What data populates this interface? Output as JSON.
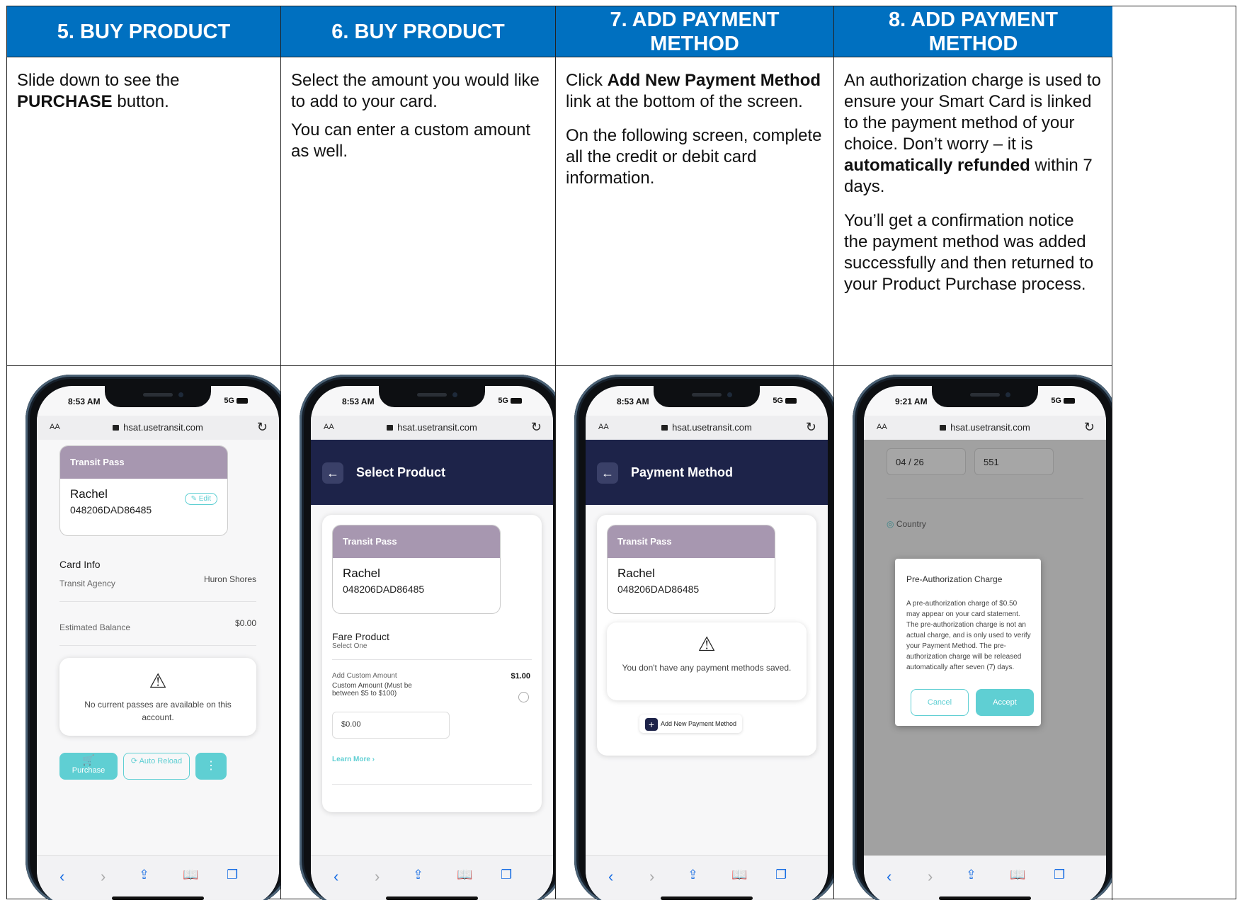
{
  "columns": [
    {
      "header": "5.  BUY PRODUCT",
      "desc": [
        "Slide down to see the",
        "PURCHASE",
        " button."
      ]
    },
    {
      "header": "6.  BUY PRODUCT",
      "desc1": "Select the amount you would like to add to your card.",
      "desc2": "You can enter a custom amount as well."
    },
    {
      "header": "7.  ADD PAYMENT METHOD",
      "desc1a": "Click ",
      "desc1b": "Add New Payment Method",
      "desc1c": " link at the bottom of the screen.",
      "desc2": "On the following screen, complete all the credit or debit card information."
    },
    {
      "header": "8.  ADD PAYMENT METHOD",
      "desc1a": "An authorization charge is used to ensure your Smart Card is linked to the payment method of your choice. Don’t worry – it is ",
      "desc1b": "automatically refunded",
      "desc1c": " within 7 days.",
      "desc2": "You’ll get a confirmation notice the payment method was added successfully and then returned to your Product Purchase process."
    }
  ],
  "phone": {
    "url": "hsat.usetransit.com",
    "aa": "AA",
    "signal": "5G",
    "times": [
      "8:53 AM",
      "8:53 AM",
      "8:53 AM",
      "9:21 AM"
    ]
  },
  "screen1": {
    "pass_title": "Transit Pass",
    "name": "Rachel",
    "card_number": "048206DAD86485",
    "edit": "Edit",
    "card_info": "Card Info",
    "transit_agency_label": "Transit Agency",
    "transit_agency_value": "Huron Shores",
    "balance_label": "Estimated Balance",
    "balance_value": "$0.00",
    "no_passes": "No current passes are available on this account.",
    "purchase": "Purchase",
    "auto_reload": "Auto Reload"
  },
  "screen2": {
    "title": "Select Product",
    "pass_title": "Transit Pass",
    "name": "Rachel",
    "card_number": "048206DAD86485",
    "fare_product": "Fare Product",
    "select_one": "Select One",
    "add_custom": "Add Custom Amount",
    "custom_desc": "Custom Amount (Must be between $5 to $100)",
    "custom_price": "$1.00",
    "amount_value": "$0.00",
    "learn_more": "Learn More"
  },
  "screen3": {
    "title": "Payment Method",
    "pass_title": "Transit Pass",
    "name": "Rachel",
    "card_number": "048206DAD86485",
    "no_methods": "You don't have any payment methods saved.",
    "add_new": "Add New Payment Method"
  },
  "screen4": {
    "expiration": "04 / 26",
    "security": "551",
    "country": "Country",
    "modal_title": "Pre-Authorization Charge",
    "modal_body": "A pre-authorization charge of $0.50 may appear on your card statement. The pre-authorization charge is not an actual charge, and is only used to verify your Payment Method. The pre-authorization charge will be released automatically after seven (7) days.",
    "cancel": "Cancel",
    "accept": "Accept"
  }
}
